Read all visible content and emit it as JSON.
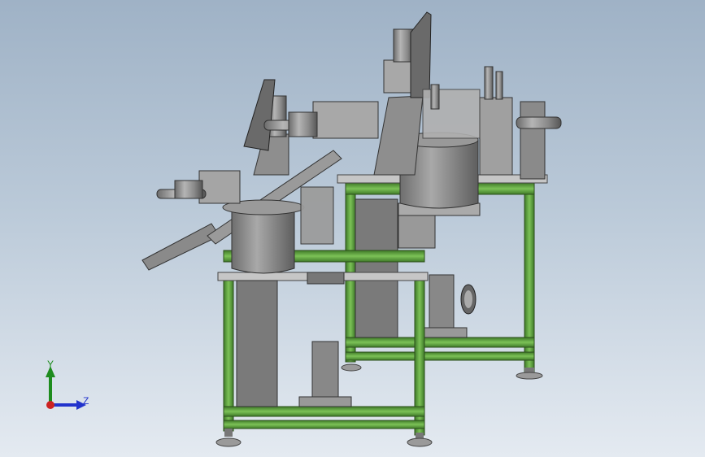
{
  "viewport": {
    "background_top": "#9fb2c6",
    "background_bottom": "#e4eaf1"
  },
  "model": {
    "frame_color": "#5a9a3a",
    "metal_color": "#8c8c8c",
    "dark_metal_color": "#5a5a5a",
    "plate_color": "#b8b8b8"
  },
  "triad": {
    "y_label": "Y",
    "z_label": "Z",
    "y_color": "#1e8c1e",
    "z_color": "#2233cc",
    "x_color": "#cc2222"
  }
}
